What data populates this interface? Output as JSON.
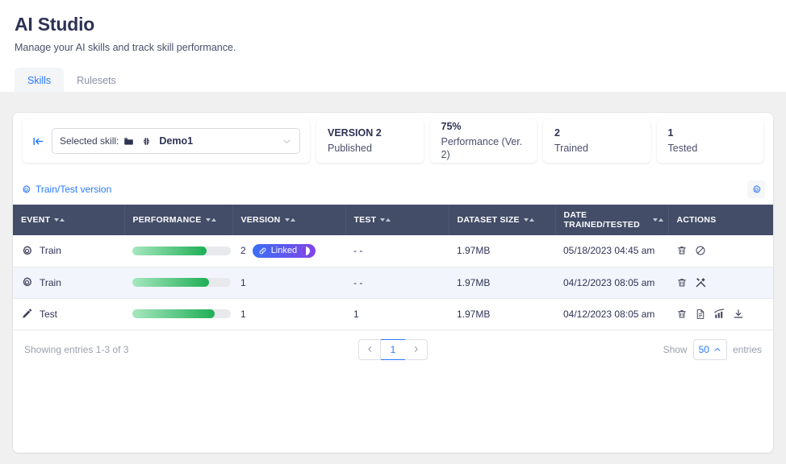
{
  "header": {
    "title": "AI Studio",
    "subtitle": "Manage your AI skills and track skill performance."
  },
  "tabs": [
    {
      "label": "Skills",
      "active": true
    },
    {
      "label": "Rulesets",
      "active": false
    }
  ],
  "selector": {
    "collapse_icon": "collapse-left-icon",
    "label": "Selected skill:",
    "folder_icon": "folder-icon",
    "brain_icon": "brain-icon",
    "value": "Demo1",
    "chevron_icon": "chevron-down-icon"
  },
  "stats": [
    {
      "value": "VERSION 2",
      "label": "Published"
    },
    {
      "value": "75%",
      "label": "Performance (Ver. 2)"
    },
    {
      "value": "2",
      "label": "Trained"
    },
    {
      "value": "1",
      "label": "Tested"
    }
  ],
  "toolbar": {
    "gear_icon": "gear-icon",
    "link_label": "Train/Test version",
    "settings_icon": "gear-icon"
  },
  "table": {
    "columns": [
      {
        "label": "EVENT",
        "sortable": true
      },
      {
        "label": "PERFORMANCE",
        "sortable": true
      },
      {
        "label": "VERSION",
        "sortable": true
      },
      {
        "label": "TEST",
        "sortable": true
      },
      {
        "label": "DATASET SIZE",
        "sortable": true
      },
      {
        "label": "DATE TRAINED/TESTED",
        "sortable": true
      },
      {
        "label": "ACTIONS",
        "sortable": false
      }
    ],
    "rows": [
      {
        "event": "Train",
        "event_icon": "gear-icon",
        "performance": 75,
        "version": "2",
        "badge": {
          "label": "Linked",
          "icon": "link-icon",
          "info_icon": "info-icon"
        },
        "test": "- -",
        "dataset_size": "1.97MB",
        "date": "05/18/2023 04:45 am",
        "actions": [
          "trash-icon",
          "block-icon"
        ],
        "alt": false
      },
      {
        "event": "Train",
        "event_icon": "gear-icon",
        "performance": 78,
        "version": "1",
        "badge": null,
        "test": "- -",
        "dataset_size": "1.97MB",
        "date": "04/12/2023 08:05 am",
        "actions": [
          "trash-icon",
          "tools-icon"
        ],
        "alt": true
      },
      {
        "event": "Test",
        "event_icon": "pen-icon",
        "performance": 84,
        "version": "1",
        "badge": null,
        "test": "1",
        "dataset_size": "1.97MB",
        "date": "04/12/2023 08:05 am",
        "actions": [
          "trash-icon",
          "document-icon",
          "chart-icon",
          "download-icon"
        ],
        "alt": false
      }
    ]
  },
  "footer": {
    "showing": "Showing entries 1-3 of 3",
    "prev_icon": "chevron-left-icon",
    "page": "1",
    "next_icon": "chevron-right-icon",
    "show_label": "Show",
    "page_size": "50",
    "page_size_icon": "chevron-up-icon",
    "entries_label": "entries"
  },
  "colors": {
    "accent": "#2979ff",
    "table_header": "#434d68",
    "progress_start": "#a6e7bf",
    "progress_end": "#1faf55",
    "badge_start": "#3b6ef5",
    "badge_end": "#8046ea",
    "title": "#2e3354"
  }
}
